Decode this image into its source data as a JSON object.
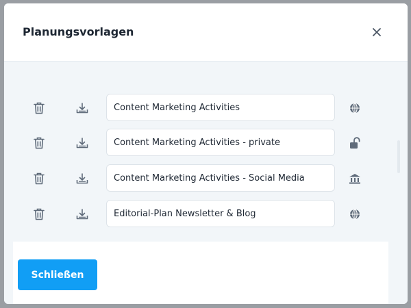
{
  "dialog": {
    "title": "Planungsvorlagen",
    "close_icon": "close-icon"
  },
  "templates": [
    {
      "name": "Content Marketing Activities",
      "visibility_icon": "globe-icon"
    },
    {
      "name": "Content Marketing Activities - private",
      "visibility_icon": "unlock-icon"
    },
    {
      "name": "Content Marketing Activities - Social Media",
      "visibility_icon": "building-icon"
    },
    {
      "name": "Editorial-Plan Newsletter & Blog",
      "visibility_icon": "globe-icon"
    }
  ],
  "footer": {
    "close_label": "Schließen"
  },
  "colors": {
    "primary": "#119ef5",
    "icon": "#5f6b7a",
    "text": "#1e2733"
  }
}
